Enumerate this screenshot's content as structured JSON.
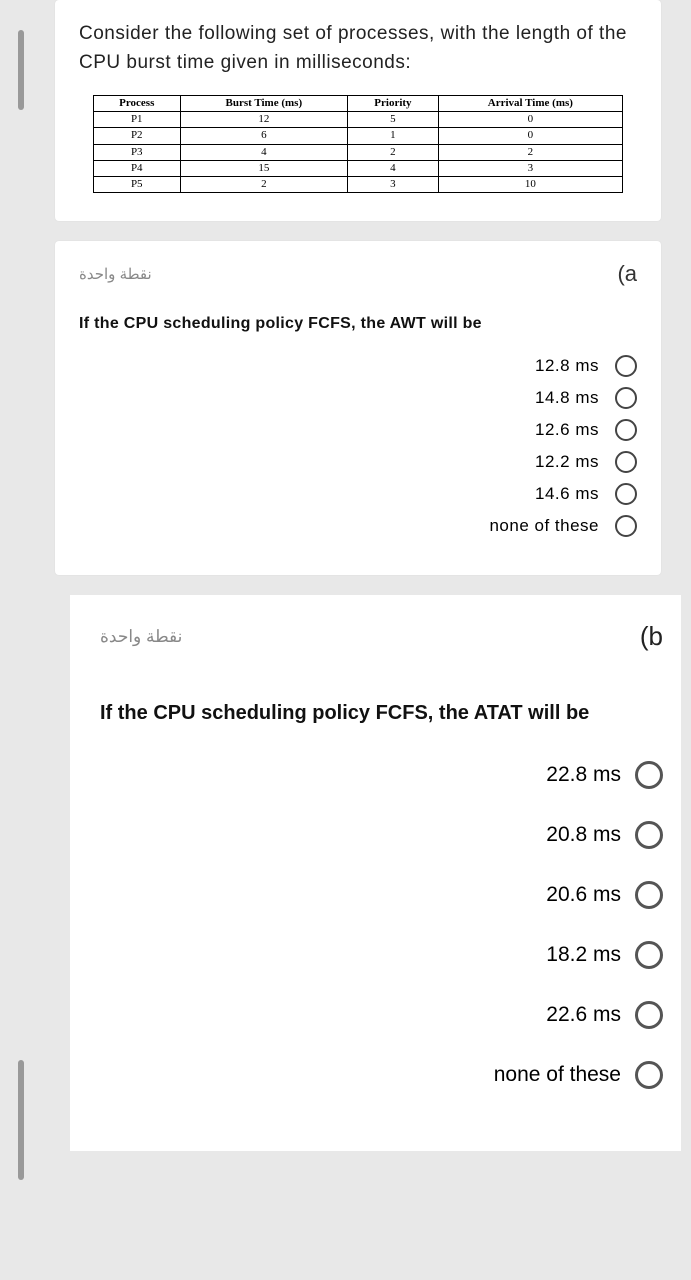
{
  "intro": "Consider the following set of processes, with the length of the CPU burst time given in milliseconds:",
  "table": {
    "headers": [
      "Process",
      "Burst Time (ms)",
      "Priority",
      "Arrival Time (ms)"
    ],
    "rows": [
      [
        "P1",
        "12",
        "5",
        "0"
      ],
      [
        "P2",
        "6",
        "1",
        "0"
      ],
      [
        "P3",
        "4",
        "2",
        "2"
      ],
      [
        "P4",
        "15",
        "4",
        "3"
      ],
      [
        "P5",
        "2",
        "3",
        "10"
      ]
    ]
  },
  "qa": {
    "points": "نقطة واحدة",
    "letter": "(a",
    "text": "If the CPU scheduling policy FCFS, the AWT will be",
    "options": [
      "12.8 ms",
      "14.8 ms",
      "12.6 ms",
      "12.2 ms",
      "14.6 ms",
      "none of these"
    ]
  },
  "qb": {
    "points": "نقطة واحدة",
    "letter": "(b",
    "text": "If the CPU scheduling policy FCFS, the ATAT will be",
    "options": [
      "22.8 ms",
      "20.8 ms",
      "20.6 ms",
      "18.2 ms",
      "22.6 ms",
      "none of these"
    ]
  }
}
